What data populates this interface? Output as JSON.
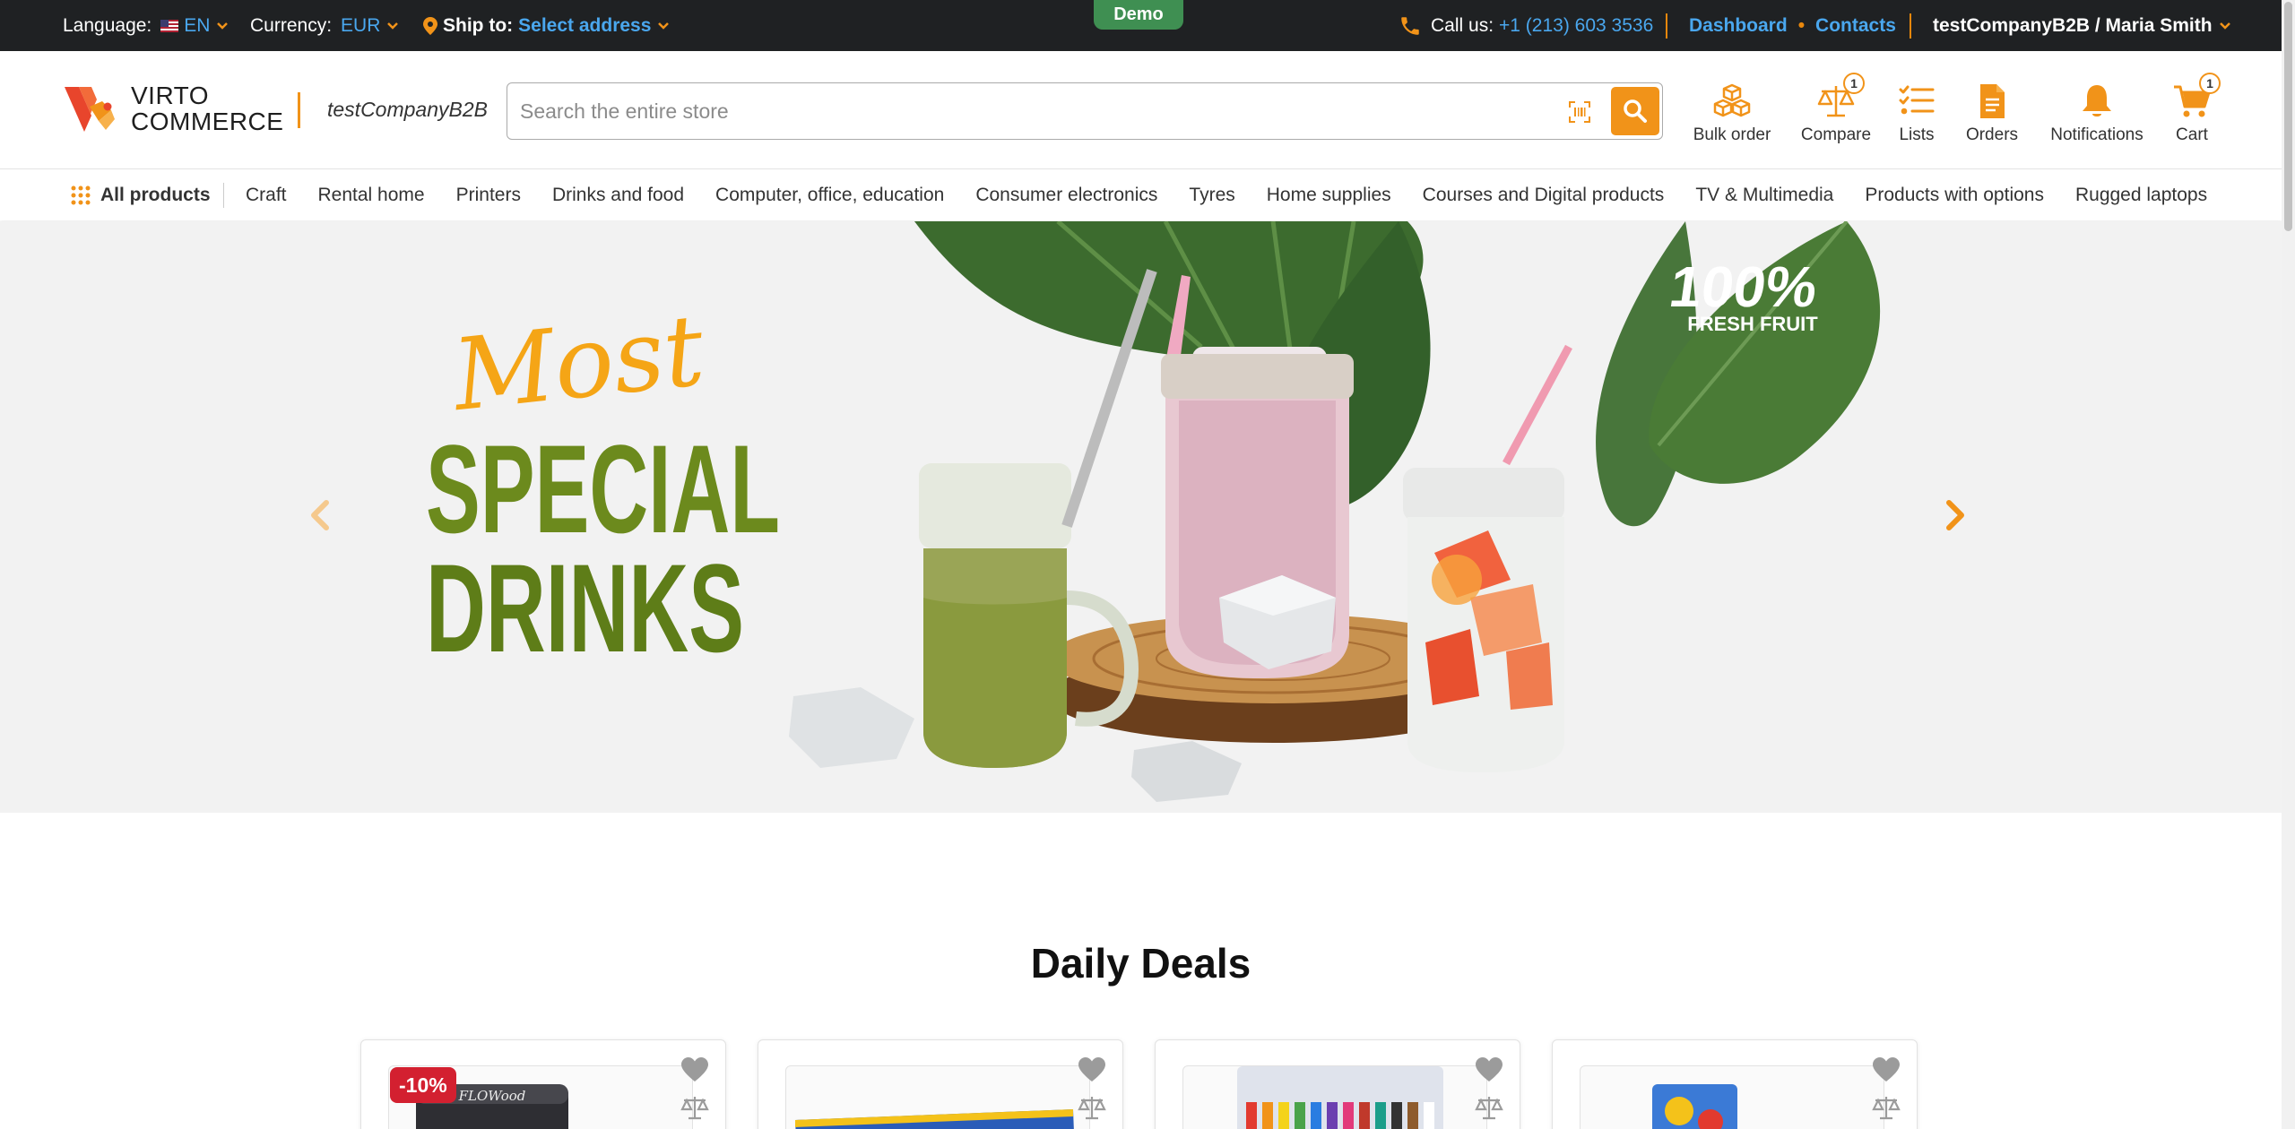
{
  "topbar": {
    "language_label": "Language:",
    "language_value": "EN",
    "currency_label": "Currency:",
    "currency_value": "EUR",
    "ship_label": "Ship to:",
    "ship_value": "Select address",
    "demo_badge": "Demo",
    "call_label": "Call us:",
    "phone": "+1 (213) 603 3536",
    "dashboard": "Dashboard",
    "separator": "•",
    "contacts": "Contacts",
    "account": "testCompanyB2B / Maria Smith"
  },
  "header": {
    "logo_line1": "VIRTO",
    "logo_line2": "COMMERCE",
    "company": "testCompanyB2B",
    "search_placeholder": "Search the entire store",
    "icons": [
      {
        "name": "bulk-order",
        "label": "Bulk order",
        "icon": "cubes-icon"
      },
      {
        "name": "compare",
        "label": "Compare",
        "icon": "scales-icon",
        "badge": "1"
      },
      {
        "name": "lists",
        "label": "Lists",
        "icon": "checklist-icon"
      },
      {
        "name": "orders",
        "label": "Orders",
        "icon": "document-icon"
      },
      {
        "name": "notifications",
        "label": "Notifications",
        "icon": "bell-icon"
      },
      {
        "name": "cart",
        "label": "Cart",
        "icon": "cart-icon",
        "badge": "1"
      }
    ]
  },
  "nav": {
    "all_products": "All products",
    "categories": [
      "Craft",
      "Rental home",
      "Printers",
      "Drinks and food",
      "Computer, office, education",
      "Consumer electronics",
      "Tyres",
      "Home supplies",
      "Courses and Digital products",
      "TV & Multimedia",
      "Products with options",
      "Rugged laptops"
    ]
  },
  "hero": {
    "script_word": "Most",
    "line1": "SPECIAL",
    "line2": "DRINKS",
    "stamp_big": "100%",
    "stamp_small": "FRESH FRUIT"
  },
  "deals": {
    "title": "Daily Deals",
    "cards": [
      {
        "discount": "-10%",
        "image_text": "FLOWood"
      },
      {
        "discount": null,
        "image_text": ""
      },
      {
        "discount": null,
        "image_text": ""
      },
      {
        "discount": null,
        "image_text": ""
      }
    ]
  },
  "colors": {
    "accent": "#f19319",
    "topbar_bg": "#1f2123",
    "link": "#4aa7ee",
    "demo": "#3f8f52",
    "discount": "#d32030"
  }
}
